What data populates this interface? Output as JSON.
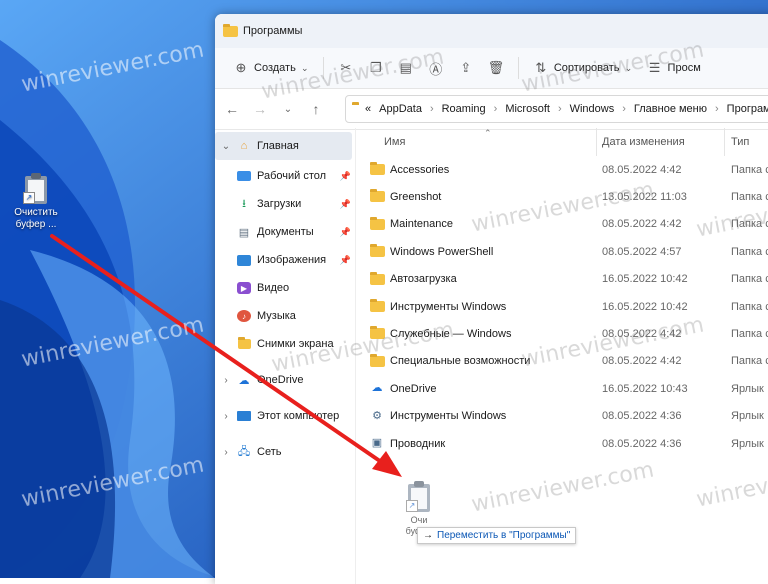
{
  "desktop": {
    "icon_label": "Очистить буфер ...",
    "watermark": "winreviewer.com"
  },
  "window": {
    "title": "Программы"
  },
  "toolbar": {
    "new_label": "Создать",
    "sort_label": "Сортировать",
    "view_label": "Просм"
  },
  "address": {
    "overflow": "«",
    "crumbs": [
      "AppData",
      "Roaming",
      "Microsoft",
      "Windows",
      "Главное меню",
      "Программ"
    ]
  },
  "sidebar": {
    "items": [
      {
        "label": "Главная",
        "icon": "home-icon"
      },
      {
        "label": "Рабочий стол",
        "icon": "desktop-icon"
      },
      {
        "label": "Загрузки",
        "icon": "download-icon"
      },
      {
        "label": "Документы",
        "icon": "documents-icon"
      },
      {
        "label": "Изображения",
        "icon": "pictures-icon"
      },
      {
        "label": "Видео",
        "icon": "video-icon"
      },
      {
        "label": "Музыка",
        "icon": "music-icon"
      },
      {
        "label": "Снимки экрана",
        "icon": "folder-icon"
      },
      {
        "label": "OneDrive",
        "icon": "cloud-icon"
      },
      {
        "label": "Этот компьютер",
        "icon": "computer-icon"
      },
      {
        "label": "Сеть",
        "icon": "network-icon"
      }
    ]
  },
  "columns": {
    "name": "Имя",
    "date": "Дата изменения",
    "type": "Тип"
  },
  "files": [
    {
      "name": "Accessories",
      "date": "08.05.2022 4:42",
      "type": "Папка с",
      "kind": "folder"
    },
    {
      "name": "Greenshot",
      "date": "13.05.2022 11:03",
      "type": "Папка с",
      "kind": "folder"
    },
    {
      "name": "Maintenance",
      "date": "08.05.2022 4:42",
      "type": "Папка с",
      "kind": "folder"
    },
    {
      "name": "Windows PowerShell",
      "date": "08.05.2022 4:57",
      "type": "Папка с",
      "kind": "folder"
    },
    {
      "name": "Автозагрузка",
      "date": "16.05.2022 10:42",
      "type": "Папка с",
      "kind": "folder"
    },
    {
      "name": "Инструменты Windows",
      "date": "16.05.2022 10:42",
      "type": "Папка с",
      "kind": "folder"
    },
    {
      "name": "Служебные — Windows",
      "date": "08.05.2022 4:42",
      "type": "Папка с",
      "kind": "folder"
    },
    {
      "name": "Специальные возможности",
      "date": "08.05.2022 4:42",
      "type": "Папка с",
      "kind": "folder"
    },
    {
      "name": "OneDrive",
      "date": "16.05.2022 10:43",
      "type": "Ярлык",
      "kind": "shortcut"
    },
    {
      "name": "Инструменты Windows",
      "date": "08.05.2022 4:36",
      "type": "Ярлык",
      "kind": "shortcut"
    },
    {
      "name": "Проводник",
      "date": "08.05.2022 4:36",
      "type": "Ярлык",
      "kind": "shortcut"
    }
  ],
  "drag": {
    "ghost_label": "Очи буфер",
    "tooltip": "Переместить в \"Программы\""
  }
}
